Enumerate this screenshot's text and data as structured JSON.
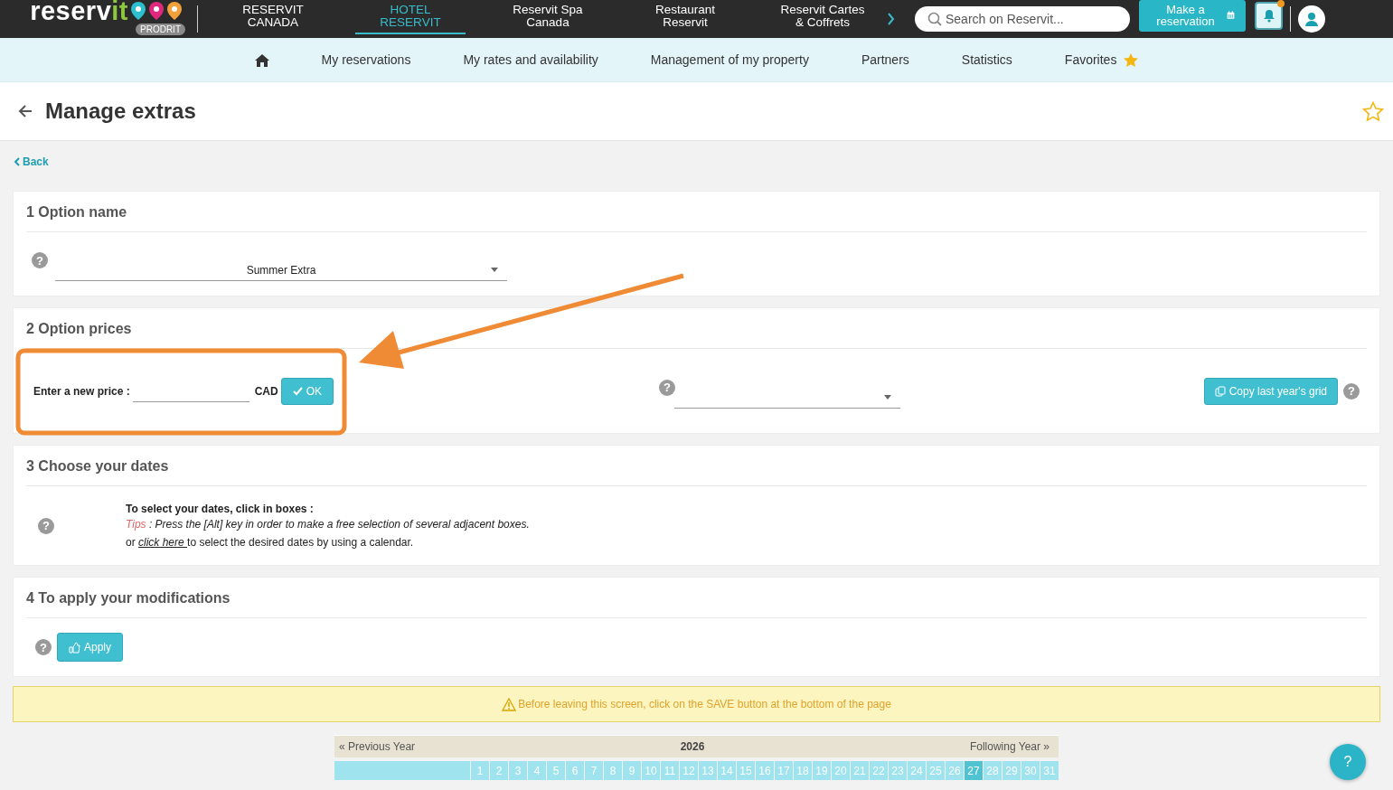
{
  "header": {
    "logo": {
      "text": "reserv",
      "accent": "it"
    },
    "logo_badge": "PRODRIT",
    "nav": [
      {
        "label": "RESERVIT CANADA",
        "selected": false
      },
      {
        "label": "HOTEL RESERVIT",
        "selected": true
      },
      {
        "label": "Reservit Spa Canada",
        "selected": false
      },
      {
        "label": "Restaurant Reservit",
        "selected": false
      },
      {
        "label": "Reservit Cartes & Coffrets",
        "selected": false
      }
    ],
    "search": {
      "placeholder": "Search on Reservit..."
    },
    "reserve_button": "Make a reservation",
    "notifications": {
      "unread": true
    }
  },
  "subnav": {
    "items": [
      {
        "kind": "home"
      },
      {
        "kind": "link",
        "label": "My reservations"
      },
      {
        "kind": "link",
        "label": "My rates and availability"
      },
      {
        "kind": "link",
        "label": "Management of my property"
      },
      {
        "kind": "link",
        "label": "Partners"
      },
      {
        "kind": "link",
        "label": "Statistics"
      },
      {
        "kind": "favorites",
        "label": "Favorites"
      }
    ]
  },
  "page": {
    "title": "Manage extras",
    "back_link": "Back"
  },
  "sections": [
    {
      "kind": "option_name",
      "title": "1 Option name",
      "help": "?",
      "select_value": "Summer Extra"
    },
    {
      "kind": "prices",
      "title": "2 Option prices",
      "price_label": "Enter a new price :",
      "currency": "CAD",
      "ok_button": "OK",
      "help": "?",
      "copy_button": "Copy last year's grid",
      "copy_help": "?"
    },
    {
      "kind": "dates",
      "title": "3 Choose your dates",
      "help": "?",
      "heading": "To select your dates, click in boxes :",
      "tips_label": "Tips",
      "tips_text": " : Press the [Alt] key in order to make a free selection of several adjacent boxes.",
      "link_prefix": "or ",
      "link": "click here ",
      "link_suffix": "to select the desired dates by using a calendar."
    },
    {
      "kind": "apply",
      "title": "4 To apply your modifications",
      "help": "?",
      "apply_button": "Apply"
    }
  ],
  "warning": "Before leaving this screen, click on the SAVE button at the bottom of the page",
  "calendar": {
    "previous": "« Previous Year",
    "year": "2026",
    "next": "Following Year »",
    "days": [
      {
        "label": "1",
        "selected": false
      },
      {
        "label": "2",
        "selected": false
      },
      {
        "label": "3",
        "selected": false
      },
      {
        "label": "4",
        "selected": false
      },
      {
        "label": "5",
        "selected": false
      },
      {
        "label": "6",
        "selected": false
      },
      {
        "label": "7",
        "selected": false
      },
      {
        "label": "8",
        "selected": false
      },
      {
        "label": "9",
        "selected": false
      },
      {
        "label": "10",
        "selected": false
      },
      {
        "label": "11",
        "selected": false
      },
      {
        "label": "12",
        "selected": false
      },
      {
        "label": "13",
        "selected": false
      },
      {
        "label": "14",
        "selected": false
      },
      {
        "label": "15",
        "selected": false
      },
      {
        "label": "16",
        "selected": false
      },
      {
        "label": "17",
        "selected": false
      },
      {
        "label": "18",
        "selected": false
      },
      {
        "label": "19",
        "selected": false
      },
      {
        "label": "20",
        "selected": false
      },
      {
        "label": "21",
        "selected": false
      },
      {
        "label": "22",
        "selected": false
      },
      {
        "label": "23",
        "selected": false
      },
      {
        "label": "24",
        "selected": false
      },
      {
        "label": "25",
        "selected": false
      },
      {
        "label": "26",
        "selected": false
      },
      {
        "label": "27",
        "selected": true
      },
      {
        "label": "28",
        "selected": false
      },
      {
        "label": "29",
        "selected": false
      },
      {
        "label": "30",
        "selected": false
      },
      {
        "label": "31",
        "selected": false
      }
    ]
  },
  "help_button": "?"
}
